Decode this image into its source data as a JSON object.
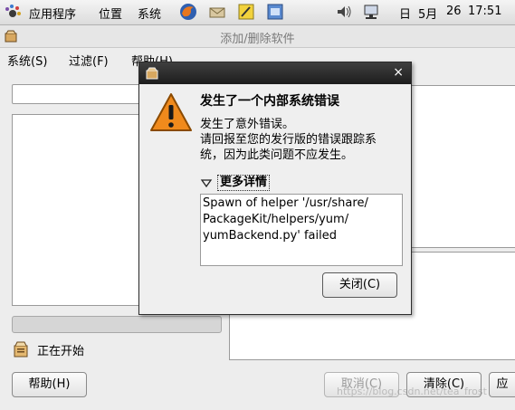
{
  "top_panel": {
    "menus": [
      "应用程序",
      "位置",
      "系统"
    ],
    "clock": {
      "day": "日",
      "month": "5月",
      "date": "26",
      "time": "17:51"
    }
  },
  "window": {
    "title": "添加/删除软件",
    "menus": [
      "系统(S)",
      "过滤(F)",
      "帮助(H)"
    ],
    "progress": 0,
    "status_text": "正在开始",
    "buttons": {
      "help": "帮助(H)",
      "cancel": "取消(C)",
      "clear": "清除(C)",
      "apply_partial": "应"
    }
  },
  "dialog": {
    "close_symbol": "×",
    "heading": "发生了一个内部系统错误",
    "message_lines": [
      "发生了意外错误。",
      "请回报至您的发行版的错误跟踪系",
      "统，因为此类问题不应发生。"
    ],
    "details_label": "更多详情",
    "details_lines": [
      "Spawn of helper '/usr/share/",
      "PackageKit/helpers/yum/",
      "yumBackend.py' failed"
    ],
    "close_button": "关闭(C)"
  },
  "watermark": "https://blog.csdn.net/tea_frost",
  "colors": {
    "dialog_titlebar": "#2a2a2a",
    "warning": "#f08a1c",
    "progress_fill": "#6a8fc4"
  }
}
